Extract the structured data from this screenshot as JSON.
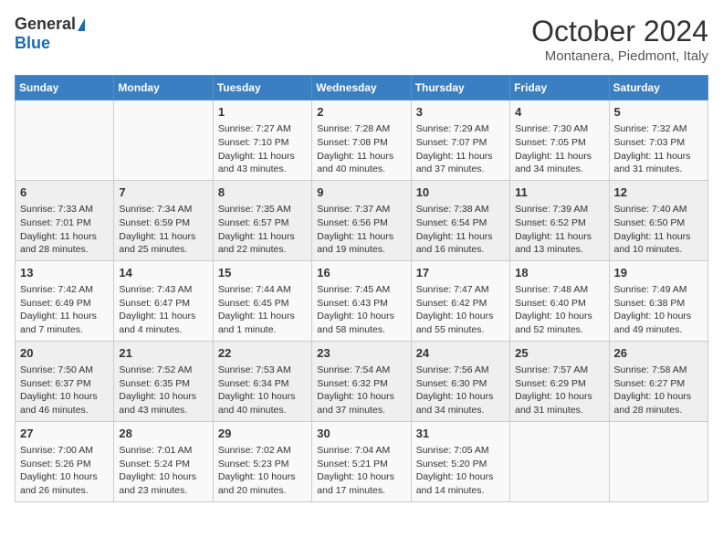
{
  "logo": {
    "general": "General",
    "blue": "Blue"
  },
  "title": "October 2024",
  "location": "Montanera, Piedmont, Italy",
  "days_of_week": [
    "Sunday",
    "Monday",
    "Tuesday",
    "Wednesday",
    "Thursday",
    "Friday",
    "Saturday"
  ],
  "weeks": [
    [
      {
        "day": "",
        "content": ""
      },
      {
        "day": "",
        "content": ""
      },
      {
        "day": "1",
        "content": "Sunrise: 7:27 AM\nSunset: 7:10 PM\nDaylight: 11 hours and 43 minutes."
      },
      {
        "day": "2",
        "content": "Sunrise: 7:28 AM\nSunset: 7:08 PM\nDaylight: 11 hours and 40 minutes."
      },
      {
        "day": "3",
        "content": "Sunrise: 7:29 AM\nSunset: 7:07 PM\nDaylight: 11 hours and 37 minutes."
      },
      {
        "day": "4",
        "content": "Sunrise: 7:30 AM\nSunset: 7:05 PM\nDaylight: 11 hours and 34 minutes."
      },
      {
        "day": "5",
        "content": "Sunrise: 7:32 AM\nSunset: 7:03 PM\nDaylight: 11 hours and 31 minutes."
      }
    ],
    [
      {
        "day": "6",
        "content": "Sunrise: 7:33 AM\nSunset: 7:01 PM\nDaylight: 11 hours and 28 minutes."
      },
      {
        "day": "7",
        "content": "Sunrise: 7:34 AM\nSunset: 6:59 PM\nDaylight: 11 hours and 25 minutes."
      },
      {
        "day": "8",
        "content": "Sunrise: 7:35 AM\nSunset: 6:57 PM\nDaylight: 11 hours and 22 minutes."
      },
      {
        "day": "9",
        "content": "Sunrise: 7:37 AM\nSunset: 6:56 PM\nDaylight: 11 hours and 19 minutes."
      },
      {
        "day": "10",
        "content": "Sunrise: 7:38 AM\nSunset: 6:54 PM\nDaylight: 11 hours and 16 minutes."
      },
      {
        "day": "11",
        "content": "Sunrise: 7:39 AM\nSunset: 6:52 PM\nDaylight: 11 hours and 13 minutes."
      },
      {
        "day": "12",
        "content": "Sunrise: 7:40 AM\nSunset: 6:50 PM\nDaylight: 11 hours and 10 minutes."
      }
    ],
    [
      {
        "day": "13",
        "content": "Sunrise: 7:42 AM\nSunset: 6:49 PM\nDaylight: 11 hours and 7 minutes."
      },
      {
        "day": "14",
        "content": "Sunrise: 7:43 AM\nSunset: 6:47 PM\nDaylight: 11 hours and 4 minutes."
      },
      {
        "day": "15",
        "content": "Sunrise: 7:44 AM\nSunset: 6:45 PM\nDaylight: 11 hours and 1 minute."
      },
      {
        "day": "16",
        "content": "Sunrise: 7:45 AM\nSunset: 6:43 PM\nDaylight: 10 hours and 58 minutes."
      },
      {
        "day": "17",
        "content": "Sunrise: 7:47 AM\nSunset: 6:42 PM\nDaylight: 10 hours and 55 minutes."
      },
      {
        "day": "18",
        "content": "Sunrise: 7:48 AM\nSunset: 6:40 PM\nDaylight: 10 hours and 52 minutes."
      },
      {
        "day": "19",
        "content": "Sunrise: 7:49 AM\nSunset: 6:38 PM\nDaylight: 10 hours and 49 minutes."
      }
    ],
    [
      {
        "day": "20",
        "content": "Sunrise: 7:50 AM\nSunset: 6:37 PM\nDaylight: 10 hours and 46 minutes."
      },
      {
        "day": "21",
        "content": "Sunrise: 7:52 AM\nSunset: 6:35 PM\nDaylight: 10 hours and 43 minutes."
      },
      {
        "day": "22",
        "content": "Sunrise: 7:53 AM\nSunset: 6:34 PM\nDaylight: 10 hours and 40 minutes."
      },
      {
        "day": "23",
        "content": "Sunrise: 7:54 AM\nSunset: 6:32 PM\nDaylight: 10 hours and 37 minutes."
      },
      {
        "day": "24",
        "content": "Sunrise: 7:56 AM\nSunset: 6:30 PM\nDaylight: 10 hours and 34 minutes."
      },
      {
        "day": "25",
        "content": "Sunrise: 7:57 AM\nSunset: 6:29 PM\nDaylight: 10 hours and 31 minutes."
      },
      {
        "day": "26",
        "content": "Sunrise: 7:58 AM\nSunset: 6:27 PM\nDaylight: 10 hours and 28 minutes."
      }
    ],
    [
      {
        "day": "27",
        "content": "Sunrise: 7:00 AM\nSunset: 5:26 PM\nDaylight: 10 hours and 26 minutes."
      },
      {
        "day": "28",
        "content": "Sunrise: 7:01 AM\nSunset: 5:24 PM\nDaylight: 10 hours and 23 minutes."
      },
      {
        "day": "29",
        "content": "Sunrise: 7:02 AM\nSunset: 5:23 PM\nDaylight: 10 hours and 20 minutes."
      },
      {
        "day": "30",
        "content": "Sunrise: 7:04 AM\nSunset: 5:21 PM\nDaylight: 10 hours and 17 minutes."
      },
      {
        "day": "31",
        "content": "Sunrise: 7:05 AM\nSunset: 5:20 PM\nDaylight: 10 hours and 14 minutes."
      },
      {
        "day": "",
        "content": ""
      },
      {
        "day": "",
        "content": ""
      }
    ]
  ]
}
